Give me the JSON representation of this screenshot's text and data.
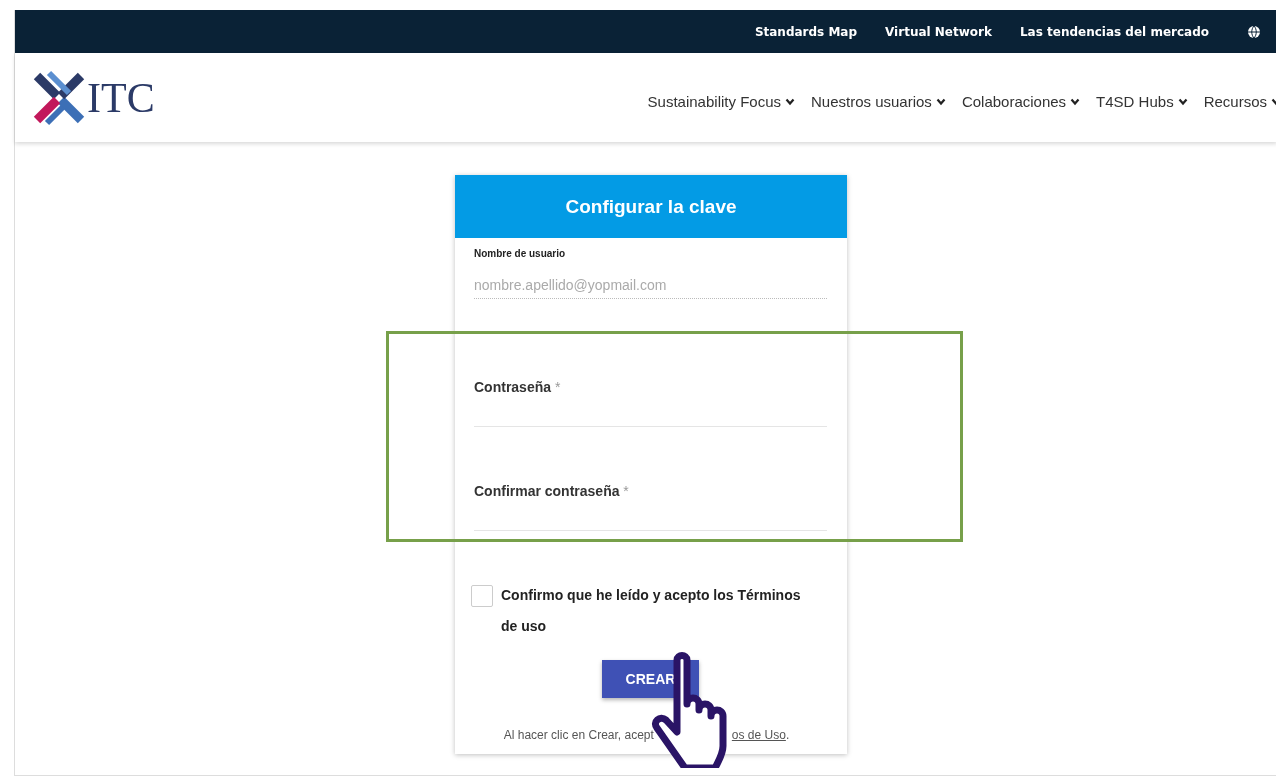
{
  "top_bar": {
    "links": [
      {
        "label": "Standards Map"
      },
      {
        "label": "Virtual Network"
      },
      {
        "label": "Las tendencias del mercado"
      }
    ]
  },
  "header": {
    "logo_text": "ITC",
    "nav": [
      {
        "label": "Sustainability Focus"
      },
      {
        "label": "Nuestros usuarios"
      },
      {
        "label": "Colaboraciones"
      },
      {
        "label": "T4SD Hubs"
      },
      {
        "label": "Recursos"
      }
    ]
  },
  "form": {
    "title": "Configurar la clave",
    "fields": [
      {
        "label": "Nombre de usuario",
        "value": "nombre.apellido@yopmail.com",
        "disabled": true
      },
      {
        "label": "Contraseña",
        "disabled": false,
        "asterisk": "*"
      },
      {
        "label": "Confirmar contraseña",
        "disabled": false,
        "asterisk": "*"
      }
    ],
    "terms": {
      "label": "Confirmo que he leído y acepto los Términos de uso",
      "checked": false
    },
    "submit": "CREAR",
    "footnote": {
      "before": "Al hacer clic en Crear, acept",
      "link": "os de Uso",
      "after": "."
    }
  }
}
